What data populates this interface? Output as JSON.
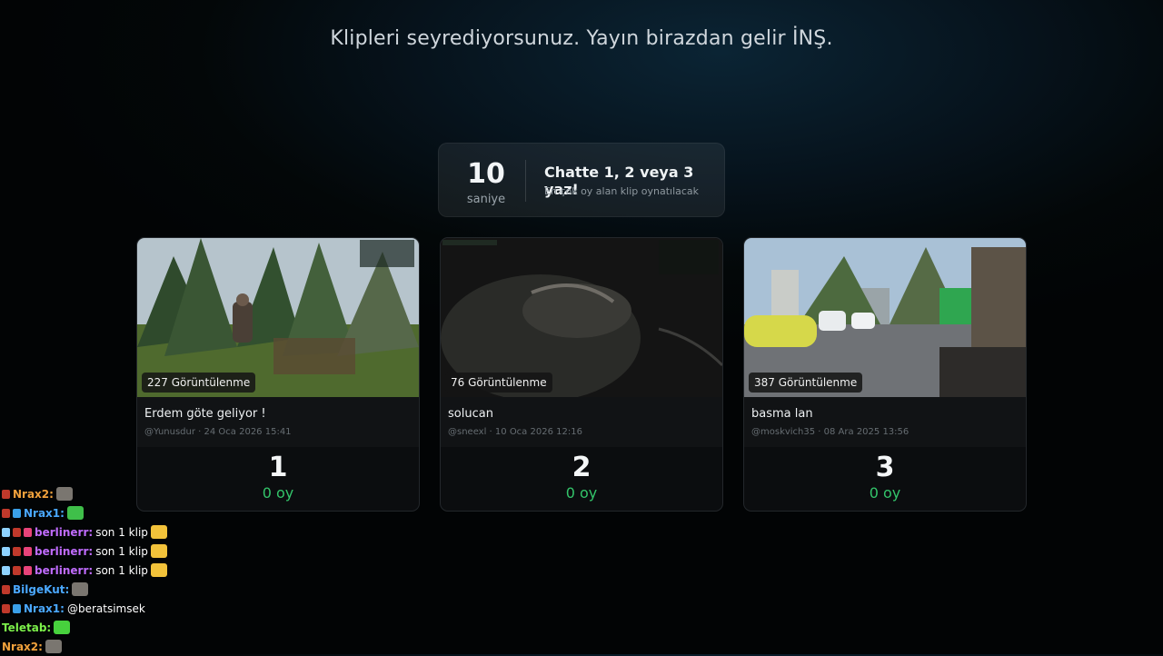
{
  "header": {
    "text": "Klipleri seyrediyorsunuz. Yayın birazdan gelir İNŞ."
  },
  "timer": {
    "count": "10",
    "unit": "saniye",
    "instruction": "Chatte 1, 2 veya 3 yaz!",
    "subtext": "En çok oy alan klip oynatılacak"
  },
  "clips": [
    {
      "views": "227 Görüntülenme",
      "title": "Erdem göte geliyor !",
      "meta": "@Yunusdur · 24 Oca 2026 15:41",
      "number": "1",
      "votes": "0 oy"
    },
    {
      "views": "76 Görüntülenme",
      "title": "solucan",
      "meta": "@sneexl · 10 Oca 2026 12:16",
      "number": "2",
      "votes": "0 oy"
    },
    {
      "views": "387 Görüntülenme",
      "title": "basma lan",
      "meta": "@moskvich35 · 08 Ara 2025 13:56",
      "number": "3",
      "votes": "0 oy"
    }
  ],
  "chat": [
    {
      "user": "Nrax2",
      "color": "#f0a13c",
      "badges": [
        "hammer-badge"
      ],
      "message": "",
      "emote": "photo-emote"
    },
    {
      "user": "Nrax1",
      "color": "#4aa8ff",
      "badges": [
        "hammer-badge",
        "cube-badge"
      ],
      "message": "",
      "emote": "green-cat-emote"
    },
    {
      "user": "berlinerr",
      "color": "#c06cff",
      "badges": [
        "sword-badge",
        "hammer-badge",
        "gift-badge"
      ],
      "message": "son 1 klip",
      "emote": "handshake-emote"
    },
    {
      "user": "berlinerr",
      "color": "#c06cff",
      "badges": [
        "sword-badge",
        "hammer-badge",
        "gift-badge"
      ],
      "message": "son 1 klip",
      "emote": "handshake-emote"
    },
    {
      "user": "berlinerr",
      "color": "#c06cff",
      "badges": [
        "sword-badge",
        "hammer-badge",
        "gift-badge"
      ],
      "message": "son 1 klip",
      "emote": "handshake-emote"
    },
    {
      "user": "BilgeKut",
      "color": "#4aa8ff",
      "badges": [
        "hammer-badge"
      ],
      "message": "",
      "emote": "photo-emote"
    },
    {
      "user": "Nrax1",
      "color": "#4aa8ff",
      "badges": [
        "hammer-badge",
        "cube-badge"
      ],
      "message": "@beratsimsek",
      "emote": ""
    },
    {
      "user": "Teletab",
      "color": "#7cf04a",
      "badges": [],
      "message": "",
      "emote": "green-blob-emote"
    },
    {
      "user": "Nrax2",
      "color": "#f0a13c",
      "badges": [],
      "message": "",
      "emote": "photo-emote"
    }
  ],
  "colors": {
    "accent": "#33c46a",
    "background": "#030708",
    "card": "#0b0d0f"
  }
}
